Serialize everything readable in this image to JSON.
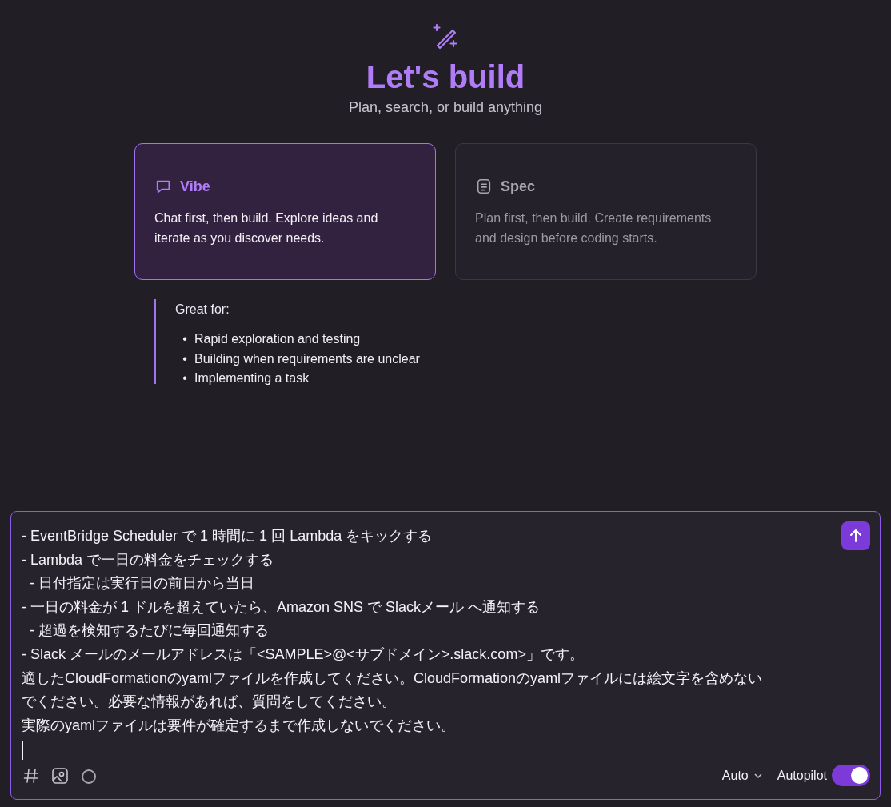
{
  "header": {
    "title": "Let's build",
    "subtitle": "Plan, search, or build anything"
  },
  "modes": [
    {
      "kind": "chat",
      "label": "Vibe",
      "description": "Chat first, then build. Explore ideas and iterate as you discover needs.",
      "selected": true
    },
    {
      "kind": "document",
      "label": "Spec",
      "description": "Plan first, then build. Create requirements and design before coding starts.",
      "selected": false
    }
  ],
  "details": {
    "heading": "Great for:",
    "items": [
      {
        "bullet": "•",
        "text": "Rapid exploration and testing"
      },
      {
        "bullet": "•",
        "text": "Building when requirements are unclear"
      },
      {
        "bullet": "•",
        "text": "Implementing a task"
      }
    ]
  },
  "prompt": {
    "lines": [
      "- EventBridge Scheduler で 1 時間に 1 回 Lambda をキックする",
      "- Lambda で一日の料金をチェックする",
      "  - 日付指定は実行日の前日から当日",
      "- 一日の料金が 1 ドルを超えていたら、Amazon SNS で Slackメール へ通知する",
      "  - 超過を検知するたびに毎回通知する",
      "- Slack メールのメールアドレスは「<SAMPLE>@<サブドメイン>.slack.com>」です。",
      "適したCloudFormationのyamlファイルを作成してください。CloudFormationのyamlファイルには絵文字を含めない",
      "でください。必要な情報があれば、質問をしてください。",
      "実際のyamlファイルは要件が確定するまで作成しないでください。"
    ],
    "model": "Auto",
    "autopilot": {
      "label": "Autopilot",
      "on": true
    }
  }
}
